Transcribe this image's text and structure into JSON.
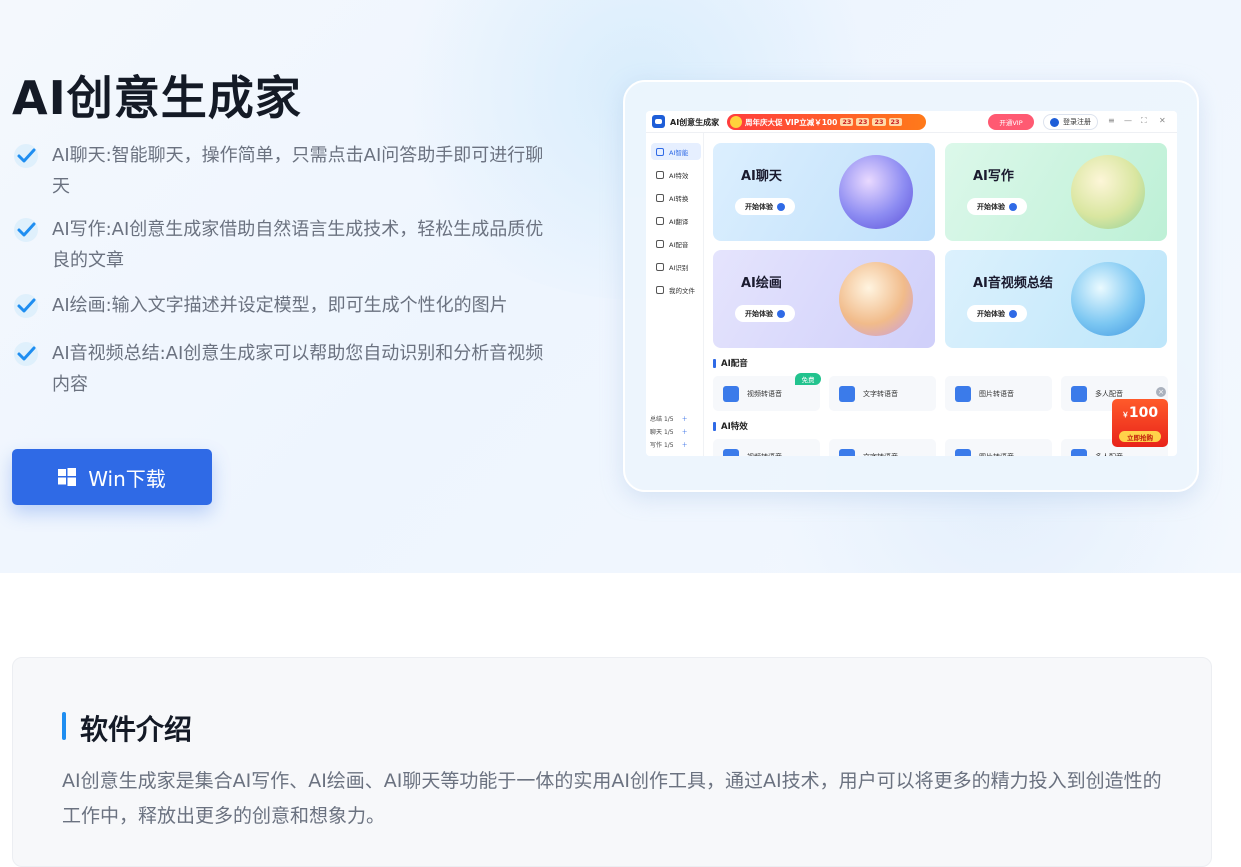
{
  "hero": {
    "title": "AI创意生成家",
    "features": [
      "AI聊天:智能聊天，操作简单，只需点击AI问答助手即可进行聊天",
      "AI写作:AI创意生成家借助自然语言生成技术，轻松生成品质优良的文章",
      "AI绘画:输入文字描述并设定模型，即可生成个性化的图片",
      "AI音视频总结:AI创意生成家可以帮助您自动识别和分析音视频内容"
    ],
    "download_label": "Win下载"
  },
  "app": {
    "name": "AI创意生成家",
    "promo": "周年庆大促 VIP立减￥100",
    "countdown": [
      "23",
      "23",
      "23",
      "23"
    ],
    "vip_label": "开通VIP",
    "login_label": "登录注册",
    "window_controls": [
      "≡",
      "—",
      "⛶",
      "✕"
    ],
    "sidebar": [
      "AI智能",
      "AI特效",
      "AI转换",
      "AI翻译",
      "AI配音",
      "AI识别",
      "我的文件"
    ],
    "quota": [
      {
        "label": "总结",
        "value": "1/5"
      },
      {
        "label": "聊天",
        "value": "1/5"
      },
      {
        "label": "写作",
        "value": "1/5"
      }
    ],
    "cards": [
      {
        "title": "AI聊天",
        "button": "开始体验"
      },
      {
        "title": "AI写作",
        "button": "开始体验"
      },
      {
        "title": "AI绘画",
        "button": "开始体验"
      },
      {
        "title": "AI音视频总结",
        "button": "开始体验"
      }
    ],
    "section_voice": "AI配音",
    "section_effects": "AI特效",
    "tools": [
      "视频转语音",
      "文字转语音",
      "图片转语音",
      "多人配音"
    ],
    "free_badge": "免费",
    "coupon_value": "100",
    "coupon_currency": "￥",
    "coupon_button": "立即抢购"
  },
  "intro": {
    "heading": "软件介绍",
    "body": "AI创意生成家是集合AI写作、AI绘画、AI聊天等功能于一体的实用AI创作工具，通过AI技术，用户可以将更多的精力投入到创造性的工作中，释放出更多的创意和想象力。"
  },
  "colors": {
    "accent": "#2f6ae6",
    "check": "#1f8ef1",
    "title": "#141a26",
    "muted": "#6b7280"
  }
}
